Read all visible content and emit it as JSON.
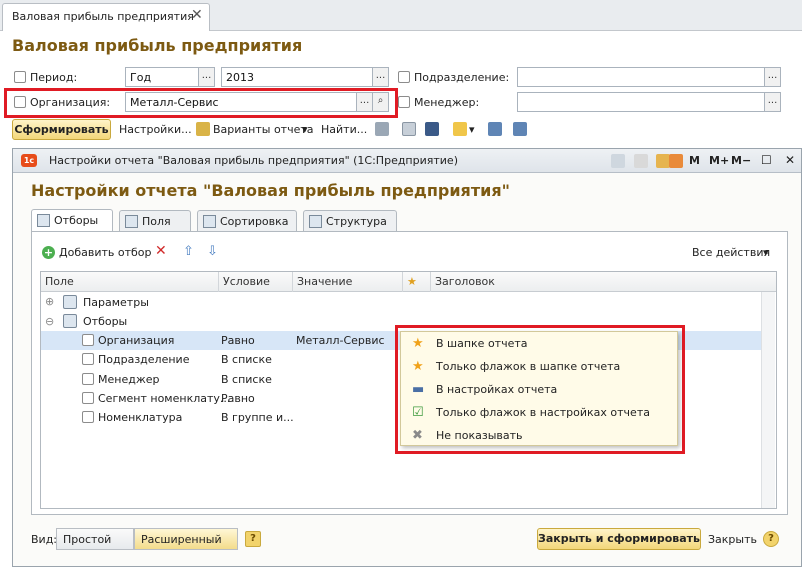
{
  "window": {
    "tab_title": "Валовая прибыль предприятия",
    "tab_close": "✕"
  },
  "form": {
    "title": "Валовая прибыль предприятия",
    "period_label": "Период:",
    "period_kind": "Год",
    "period_value": "2013",
    "division_label": "Подразделение:",
    "division_value": "",
    "org_label": "Организация:",
    "org_value": "Металл-Сервис",
    "manager_label": "Менеджер:",
    "manager_value": "",
    "ellipsis": "...",
    "search_glyph": "⌕"
  },
  "toolbar": {
    "generate_label": "Сформировать",
    "settings_label": "Настройки...",
    "variants_label": "Варианты отчета",
    "find_label": "Найти...",
    "dropdown_glyph": "▾"
  },
  "settings": {
    "window_title": "Настройки отчета \"Валовая прибыль предприятия\"  (1С:Предприятие)",
    "heading": "Настройки отчета \"Валовая прибыль предприятия\"",
    "logo": "1c",
    "title_buttons": [
      "M",
      "M+",
      "M−",
      "☐",
      "✕"
    ],
    "tabs": [
      {
        "label": "Отборы"
      },
      {
        "label": "Поля"
      },
      {
        "label": "Сортировка"
      },
      {
        "label": "Структура"
      }
    ],
    "add_filter_label": "Добавить отбор",
    "all_actions_label": "Все действия",
    "columns": [
      "Поле",
      "Условие",
      "Значение",
      "★",
      "Заголовок"
    ],
    "groups": [
      {
        "sign": "⊕",
        "label": "Параметры"
      },
      {
        "sign": "⊖",
        "label": "Отборы"
      }
    ],
    "rows": [
      {
        "field": "Организация",
        "condition": "Равно",
        "value": "Металл-Сервис"
      },
      {
        "field": "Подразделение",
        "condition": "В списке",
        "value": ""
      },
      {
        "field": "Менеджер",
        "condition": "В списке",
        "value": ""
      },
      {
        "field": "Сегмент номенклату...",
        "condition": "Равно",
        "value": ""
      },
      {
        "field": "Номенклатура",
        "condition": "В группе и...",
        "value": ""
      }
    ],
    "popup_items": [
      {
        "label": "В шапке отчета",
        "icon": "star-icon"
      },
      {
        "label": "Только флажок в шапке отчета",
        "icon": "star-check-icon"
      },
      {
        "label": "В настройках отчета",
        "icon": "dash-icon"
      },
      {
        "label": "Только флажок в настройках отчета",
        "icon": "flag-check-icon"
      },
      {
        "label": "Не показывать",
        "icon": "x-icon"
      }
    ],
    "footer": {
      "view_label": "Вид:",
      "simple_label": "Простой",
      "extended_label": "Расширенный",
      "help_glyph": "?",
      "close_generate_label": "Закрыть и сформировать",
      "close_label": "Закрыть"
    }
  },
  "colors": {
    "accent_title": "#7d5a12",
    "highlight_red": "#e01b24",
    "selection": "#d7e6f7"
  }
}
